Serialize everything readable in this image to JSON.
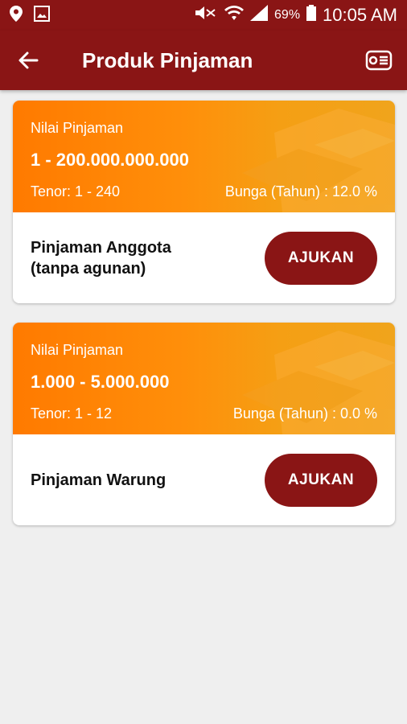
{
  "status_bar": {
    "battery_percent": "69%",
    "time": "10:05 AM",
    "icons": [
      "location-icon",
      "image-icon",
      "mute-icon",
      "wifi-icon",
      "signal-icon",
      "battery-icon"
    ]
  },
  "app_bar": {
    "title": "Produk Pinjaman",
    "back_icon": "arrow-left-icon",
    "action_icon": "coupon-list-icon"
  },
  "products": [
    {
      "label": "Nilai Pinjaman",
      "amount": "1 - 200.000.000.000",
      "tenor": "Tenor: 1 - 240",
      "interest": "Bunga (Tahun) : 12.0 %",
      "name": "Pinjaman Anggota\n(tanpa agunan)",
      "button": "AJUKAN"
    },
    {
      "label": "Nilai Pinjaman",
      "amount": "1.000 - 5.000.000",
      "tenor": "Tenor: 1 - 12",
      "interest": "Bunga (Tahun) : 0.0 %",
      "name": "Pinjaman Warung",
      "button": "AJUKAN"
    }
  ],
  "colors": {
    "primary": "#8a1515",
    "banner_orange": "#ff7a00",
    "background": "#efefef"
  }
}
